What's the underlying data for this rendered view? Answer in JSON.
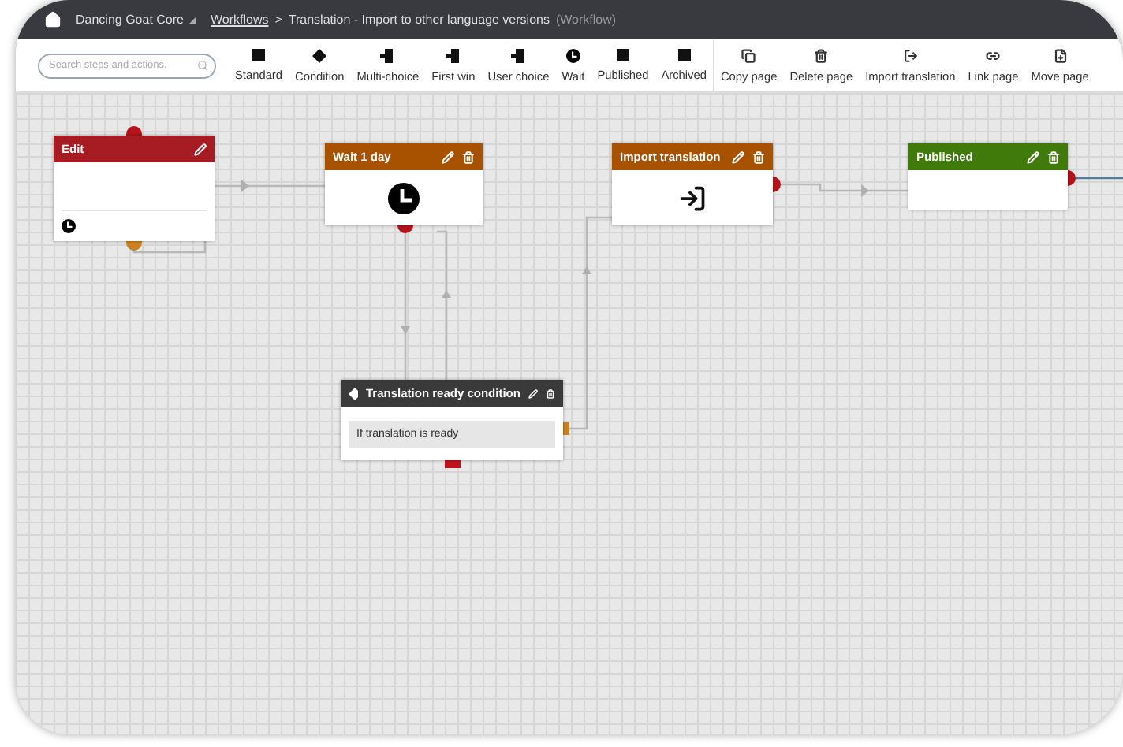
{
  "header": {
    "site": "Dancing Goat Core",
    "link": "Workflows",
    "separator": ">",
    "title": "Translation - Import to other language versions",
    "suffix": "(Workflow)"
  },
  "search": {
    "placeholder": "Search steps and actions."
  },
  "toolbar": [
    [
      "Standard",
      "Condition",
      "Multi-choice",
      "First win",
      "User choice",
      "Wait",
      "Published",
      "Archived"
    ],
    [
      "Copy page",
      "Delete page",
      "Import translation",
      "Link page",
      "Move page"
    ]
  ],
  "nodes": [
    {
      "kind": "edit",
      "title": "Edit",
      "color": "#a61c22",
      "deletable": false
    },
    {
      "kind": "wait",
      "title": "Wait 1 day",
      "color": "#a85200",
      "deletable": true
    },
    {
      "kind": "action",
      "title": "Import translation",
      "color": "#a85200",
      "deletable": true
    },
    {
      "kind": "action-empty",
      "title": "Published",
      "color": "#3f7a0a",
      "deletable": true
    },
    {
      "kind": "condition",
      "title": "Translation ready condition",
      "color": "#3a3a3a",
      "deletable": true,
      "text": "If translation is ready"
    }
  ]
}
